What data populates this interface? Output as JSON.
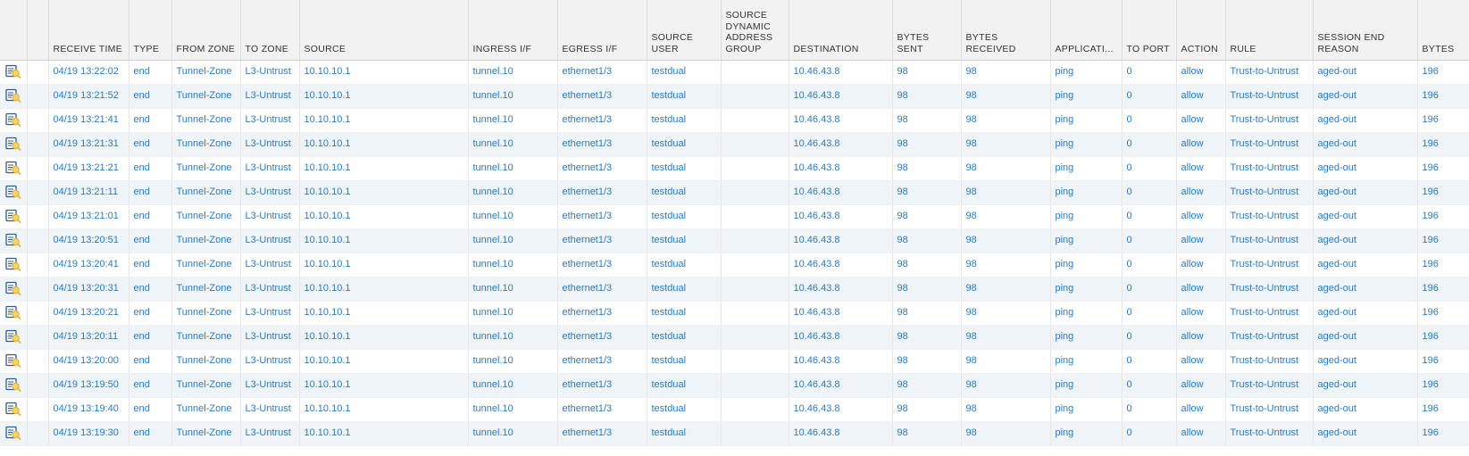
{
  "columns": [
    {
      "key": "icon",
      "label": ""
    },
    {
      "key": "blank",
      "label": ""
    },
    {
      "key": "receive_time",
      "label": "RECEIVE TIME"
    },
    {
      "key": "type",
      "label": "TYPE"
    },
    {
      "key": "from_zone",
      "label": "FROM ZONE"
    },
    {
      "key": "to_zone",
      "label": "TO ZONE"
    },
    {
      "key": "source",
      "label": "SOURCE"
    },
    {
      "key": "ingress_if",
      "label": "INGRESS I/F"
    },
    {
      "key": "egress_if",
      "label": "EGRESS I/F"
    },
    {
      "key": "source_user",
      "label": "SOURCE USER"
    },
    {
      "key": "source_dag",
      "label": "SOURCE DYNAMIC ADDRESS GROUP"
    },
    {
      "key": "destination",
      "label": "DESTINATION"
    },
    {
      "key": "bytes_sent",
      "label": "BYTES SENT"
    },
    {
      "key": "bytes_received",
      "label": "BYTES RECEIVED"
    },
    {
      "key": "application",
      "label": "APPLICATI..."
    },
    {
      "key": "to_port",
      "label": "TO PORT"
    },
    {
      "key": "action",
      "label": "ACTION"
    },
    {
      "key": "rule",
      "label": "RULE"
    },
    {
      "key": "session_end_reason",
      "label": "SESSION END REASON"
    },
    {
      "key": "bytes",
      "label": "BYTES"
    }
  ],
  "rows": [
    {
      "receive_time": "04/19 13:22:02",
      "type": "end",
      "from_zone": "Tunnel-Zone",
      "to_zone": "L3-Untrust",
      "source": "10.10.10.1",
      "ingress_if": "tunnel.10",
      "egress_if": "ethernet1/3",
      "source_user": "testdual",
      "source_dag": "",
      "destination": "10.46.43.8",
      "bytes_sent": "98",
      "bytes_received": "98",
      "application": "ping",
      "to_port": "0",
      "action": "allow",
      "rule": "Trust-to-Untrust",
      "session_end_reason": "aged-out",
      "bytes": "196"
    },
    {
      "receive_time": "04/19 13:21:52",
      "type": "end",
      "from_zone": "Tunnel-Zone",
      "to_zone": "L3-Untrust",
      "source": "10.10.10.1",
      "ingress_if": "tunnel.10",
      "egress_if": "ethernet1/3",
      "source_user": "testdual",
      "source_dag": "",
      "destination": "10.46.43.8",
      "bytes_sent": "98",
      "bytes_received": "98",
      "application": "ping",
      "to_port": "0",
      "action": "allow",
      "rule": "Trust-to-Untrust",
      "session_end_reason": "aged-out",
      "bytes": "196"
    },
    {
      "receive_time": "04/19 13:21:41",
      "type": "end",
      "from_zone": "Tunnel-Zone",
      "to_zone": "L3-Untrust",
      "source": "10.10.10.1",
      "ingress_if": "tunnel.10",
      "egress_if": "ethernet1/3",
      "source_user": "testdual",
      "source_dag": "",
      "destination": "10.46.43.8",
      "bytes_sent": "98",
      "bytes_received": "98",
      "application": "ping",
      "to_port": "0",
      "action": "allow",
      "rule": "Trust-to-Untrust",
      "session_end_reason": "aged-out",
      "bytes": "196"
    },
    {
      "receive_time": "04/19 13:21:31",
      "type": "end",
      "from_zone": "Tunnel-Zone",
      "to_zone": "L3-Untrust",
      "source": "10.10.10.1",
      "ingress_if": "tunnel.10",
      "egress_if": "ethernet1/3",
      "source_user": "testdual",
      "source_dag": "",
      "destination": "10.46.43.8",
      "bytes_sent": "98",
      "bytes_received": "98",
      "application": "ping",
      "to_port": "0",
      "action": "allow",
      "rule": "Trust-to-Untrust",
      "session_end_reason": "aged-out",
      "bytes": "196"
    },
    {
      "receive_time": "04/19 13:21:21",
      "type": "end",
      "from_zone": "Tunnel-Zone",
      "to_zone": "L3-Untrust",
      "source": "10.10.10.1",
      "ingress_if": "tunnel.10",
      "egress_if": "ethernet1/3",
      "source_user": "testdual",
      "source_dag": "",
      "destination": "10.46.43.8",
      "bytes_sent": "98",
      "bytes_received": "98",
      "application": "ping",
      "to_port": "0",
      "action": "allow",
      "rule": "Trust-to-Untrust",
      "session_end_reason": "aged-out",
      "bytes": "196"
    },
    {
      "receive_time": "04/19 13:21:11",
      "type": "end",
      "from_zone": "Tunnel-Zone",
      "to_zone": "L3-Untrust",
      "source": "10.10.10.1",
      "ingress_if": "tunnel.10",
      "egress_if": "ethernet1/3",
      "source_user": "testdual",
      "source_dag": "",
      "destination": "10.46.43.8",
      "bytes_sent": "98",
      "bytes_received": "98",
      "application": "ping",
      "to_port": "0",
      "action": "allow",
      "rule": "Trust-to-Untrust",
      "session_end_reason": "aged-out",
      "bytes": "196"
    },
    {
      "receive_time": "04/19 13:21:01",
      "type": "end",
      "from_zone": "Tunnel-Zone",
      "to_zone": "L3-Untrust",
      "source": "10.10.10.1",
      "ingress_if": "tunnel.10",
      "egress_if": "ethernet1/3",
      "source_user": "testdual",
      "source_dag": "",
      "destination": "10.46.43.8",
      "bytes_sent": "98",
      "bytes_received": "98",
      "application": "ping",
      "to_port": "0",
      "action": "allow",
      "rule": "Trust-to-Untrust",
      "session_end_reason": "aged-out",
      "bytes": "196"
    },
    {
      "receive_time": "04/19 13:20:51",
      "type": "end",
      "from_zone": "Tunnel-Zone",
      "to_zone": "L3-Untrust",
      "source": "10.10.10.1",
      "ingress_if": "tunnel.10",
      "egress_if": "ethernet1/3",
      "source_user": "testdual",
      "source_dag": "",
      "destination": "10.46.43.8",
      "bytes_sent": "98",
      "bytes_received": "98",
      "application": "ping",
      "to_port": "0",
      "action": "allow",
      "rule": "Trust-to-Untrust",
      "session_end_reason": "aged-out",
      "bytes": "196"
    },
    {
      "receive_time": "04/19 13:20:41",
      "type": "end",
      "from_zone": "Tunnel-Zone",
      "to_zone": "L3-Untrust",
      "source": "10.10.10.1",
      "ingress_if": "tunnel.10",
      "egress_if": "ethernet1/3",
      "source_user": "testdual",
      "source_dag": "",
      "destination": "10.46.43.8",
      "bytes_sent": "98",
      "bytes_received": "98",
      "application": "ping",
      "to_port": "0",
      "action": "allow",
      "rule": "Trust-to-Untrust",
      "session_end_reason": "aged-out",
      "bytes": "196"
    },
    {
      "receive_time": "04/19 13:20:31",
      "type": "end",
      "from_zone": "Tunnel-Zone",
      "to_zone": "L3-Untrust",
      "source": "10.10.10.1",
      "ingress_if": "tunnel.10",
      "egress_if": "ethernet1/3",
      "source_user": "testdual",
      "source_dag": "",
      "destination": "10.46.43.8",
      "bytes_sent": "98",
      "bytes_received": "98",
      "application": "ping",
      "to_port": "0",
      "action": "allow",
      "rule": "Trust-to-Untrust",
      "session_end_reason": "aged-out",
      "bytes": "196"
    },
    {
      "receive_time": "04/19 13:20:21",
      "type": "end",
      "from_zone": "Tunnel-Zone",
      "to_zone": "L3-Untrust",
      "source": "10.10.10.1",
      "ingress_if": "tunnel.10",
      "egress_if": "ethernet1/3",
      "source_user": "testdual",
      "source_dag": "",
      "destination": "10.46.43.8",
      "bytes_sent": "98",
      "bytes_received": "98",
      "application": "ping",
      "to_port": "0",
      "action": "allow",
      "rule": "Trust-to-Untrust",
      "session_end_reason": "aged-out",
      "bytes": "196"
    },
    {
      "receive_time": "04/19 13:20:11",
      "type": "end",
      "from_zone": "Tunnel-Zone",
      "to_zone": "L3-Untrust",
      "source": "10.10.10.1",
      "ingress_if": "tunnel.10",
      "egress_if": "ethernet1/3",
      "source_user": "testdual",
      "source_dag": "",
      "destination": "10.46.43.8",
      "bytes_sent": "98",
      "bytes_received": "98",
      "application": "ping",
      "to_port": "0",
      "action": "allow",
      "rule": "Trust-to-Untrust",
      "session_end_reason": "aged-out",
      "bytes": "196"
    },
    {
      "receive_time": "04/19 13:20:00",
      "type": "end",
      "from_zone": "Tunnel-Zone",
      "to_zone": "L3-Untrust",
      "source": "10.10.10.1",
      "ingress_if": "tunnel.10",
      "egress_if": "ethernet1/3",
      "source_user": "testdual",
      "source_dag": "",
      "destination": "10.46.43.8",
      "bytes_sent": "98",
      "bytes_received": "98",
      "application": "ping",
      "to_port": "0",
      "action": "allow",
      "rule": "Trust-to-Untrust",
      "session_end_reason": "aged-out",
      "bytes": "196"
    },
    {
      "receive_time": "04/19 13:19:50",
      "type": "end",
      "from_zone": "Tunnel-Zone",
      "to_zone": "L3-Untrust",
      "source": "10.10.10.1",
      "ingress_if": "tunnel.10",
      "egress_if": "ethernet1/3",
      "source_user": "testdual",
      "source_dag": "",
      "destination": "10.46.43.8",
      "bytes_sent": "98",
      "bytes_received": "98",
      "application": "ping",
      "to_port": "0",
      "action": "allow",
      "rule": "Trust-to-Untrust",
      "session_end_reason": "aged-out",
      "bytes": "196"
    },
    {
      "receive_time": "04/19 13:19:40",
      "type": "end",
      "from_zone": "Tunnel-Zone",
      "to_zone": "L3-Untrust",
      "source": "10.10.10.1",
      "ingress_if": "tunnel.10",
      "egress_if": "ethernet1/3",
      "source_user": "testdual",
      "source_dag": "",
      "destination": "10.46.43.8",
      "bytes_sent": "98",
      "bytes_received": "98",
      "application": "ping",
      "to_port": "0",
      "action": "allow",
      "rule": "Trust-to-Untrust",
      "session_end_reason": "aged-out",
      "bytes": "196"
    },
    {
      "receive_time": "04/19 13:19:30",
      "type": "end",
      "from_zone": "Tunnel-Zone",
      "to_zone": "L3-Untrust",
      "source": "10.10.10.1",
      "ingress_if": "tunnel.10",
      "egress_if": "ethernet1/3",
      "source_user": "testdual",
      "source_dag": "",
      "destination": "10.46.43.8",
      "bytes_sent": "98",
      "bytes_received": "98",
      "application": "ping",
      "to_port": "0",
      "action": "allow",
      "rule": "Trust-to-Untrust",
      "session_end_reason": "aged-out",
      "bytes": "196"
    }
  ],
  "row_icon": "log-detail-icon",
  "colors": {
    "link": "#2b7bc0",
    "header_bg": "#f2f2f2",
    "row_alt_bg": "#eef4f7",
    "icon_yellow": "#e8b43a"
  }
}
